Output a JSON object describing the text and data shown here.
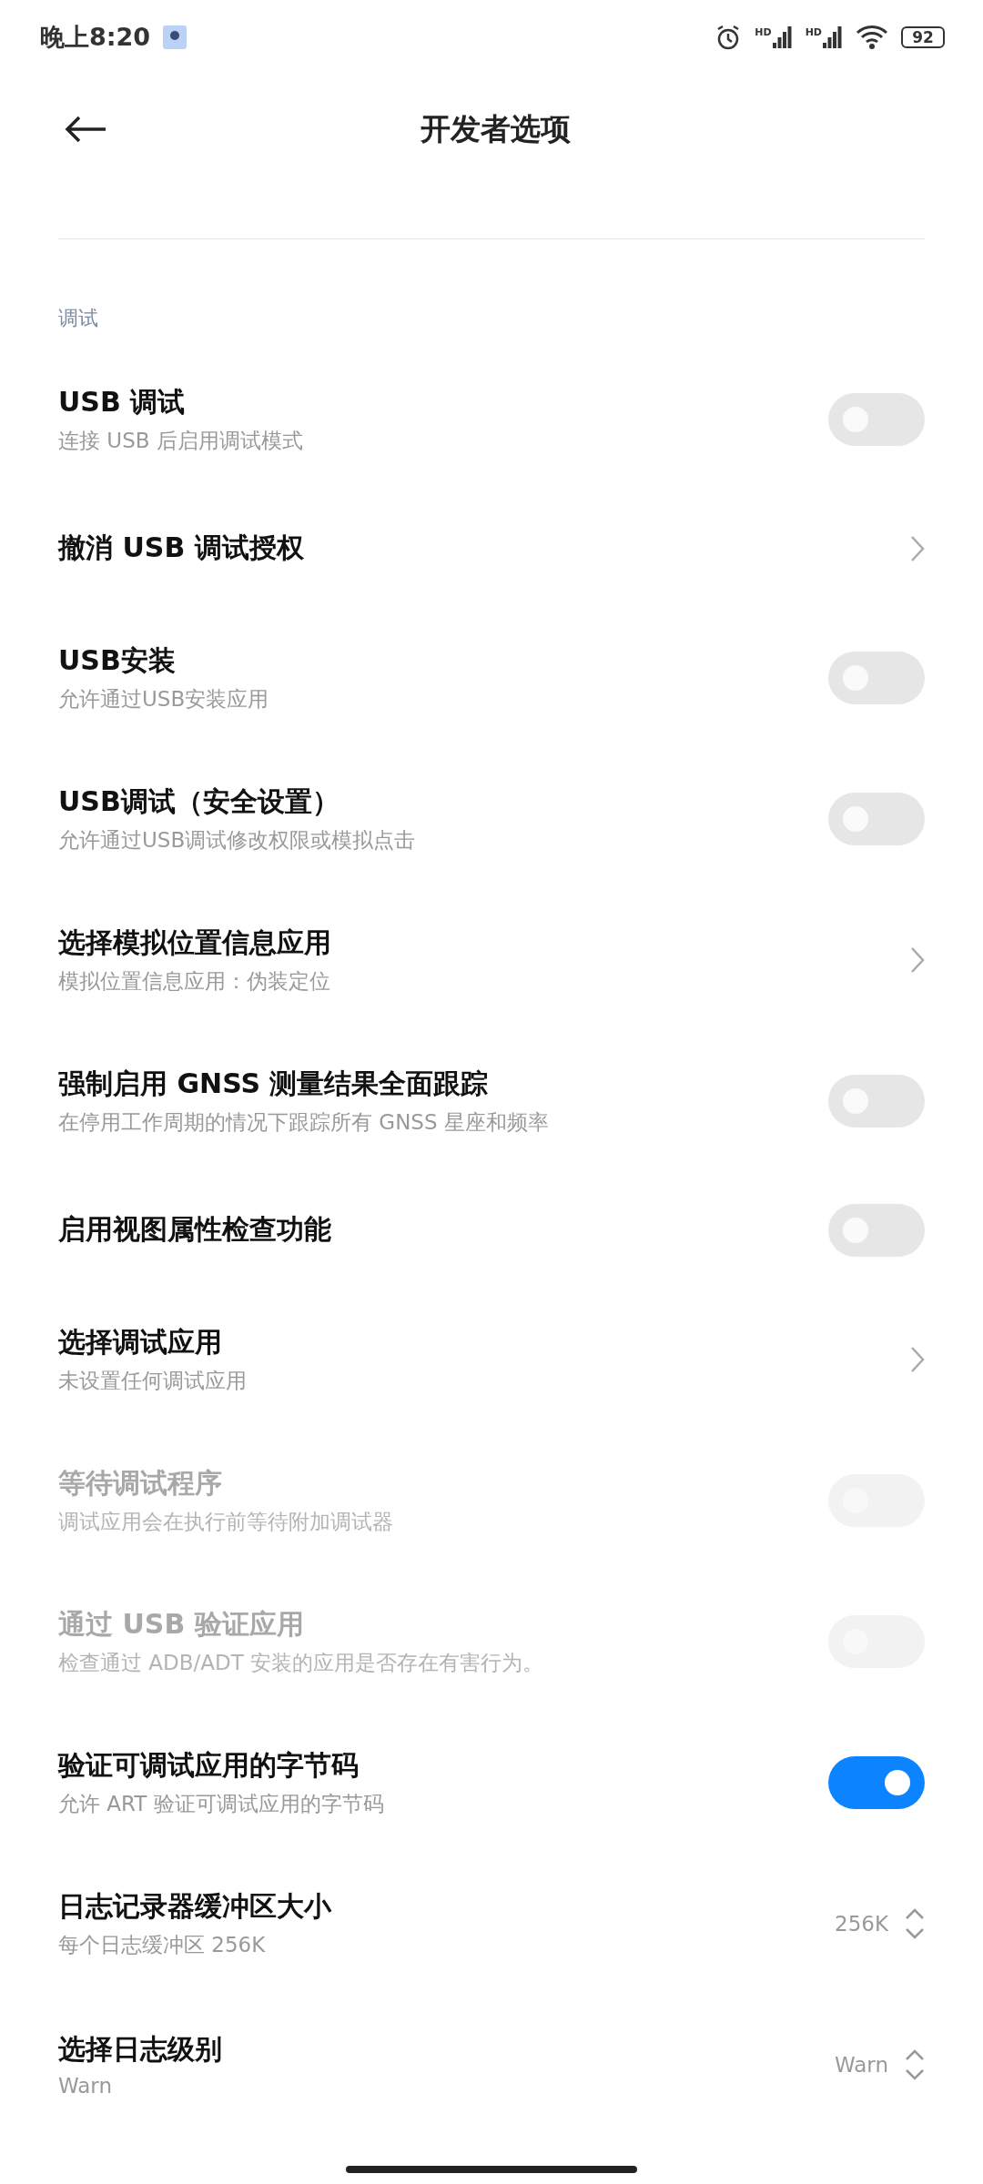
{
  "status_bar": {
    "time": "晚上8:20",
    "signals": [
      {
        "label": "HD"
      },
      {
        "label": "HD"
      }
    ],
    "battery": "92"
  },
  "header": {
    "title": "开发者选项"
  },
  "section": {
    "title": "调试"
  },
  "items": [
    {
      "kind": "toggle",
      "title": "USB 调试",
      "subtitle": "连接 USB 后启用调试模式",
      "on": false,
      "disabled": false
    },
    {
      "kind": "link",
      "title": "撤消 USB 调试授权",
      "disabled": false
    },
    {
      "kind": "toggle",
      "title": "USB安装",
      "subtitle": "允许通过USB安装应用",
      "on": false,
      "disabled": false
    },
    {
      "kind": "toggle",
      "title": "USB调试（安全设置）",
      "subtitle": "允许通过USB调试修改权限或模拟点击",
      "on": false,
      "disabled": false
    },
    {
      "kind": "link",
      "title": "选择模拟位置信息应用",
      "subtitle": "模拟位置信息应用：伪装定位",
      "disabled": false
    },
    {
      "kind": "toggle",
      "title": "强制启用 GNSS 测量结果全面跟踪",
      "subtitle": "在停用工作周期的情况下跟踪所有 GNSS 星座和频率",
      "on": false,
      "disabled": false
    },
    {
      "kind": "toggle",
      "title": "启用视图属性检查功能",
      "on": false,
      "disabled": false
    },
    {
      "kind": "link",
      "title": "选择调试应用",
      "subtitle": "未设置任何调试应用",
      "disabled": false
    },
    {
      "kind": "toggle",
      "title": "等待调试程序",
      "subtitle": "调试应用会在执行前等待附加调试器",
      "on": false,
      "disabled": true
    },
    {
      "kind": "toggle",
      "title": "通过 USB 验证应用",
      "subtitle": "检查通过 ADB/ADT 安装的应用是否存在有害行为。",
      "on": false,
      "disabled": true
    },
    {
      "kind": "toggle",
      "title": "验证可调试应用的字节码",
      "subtitle": "允许 ART 验证可调试应用的字节码",
      "on": true,
      "disabled": false
    },
    {
      "kind": "spinner",
      "title": "日志记录器缓冲区大小",
      "subtitle": "每个日志缓冲区 256K",
      "value": "256K",
      "disabled": false
    },
    {
      "kind": "spinner",
      "title": "选择日志级别",
      "subtitle": "Warn",
      "value": "Warn",
      "disabled": false
    }
  ]
}
